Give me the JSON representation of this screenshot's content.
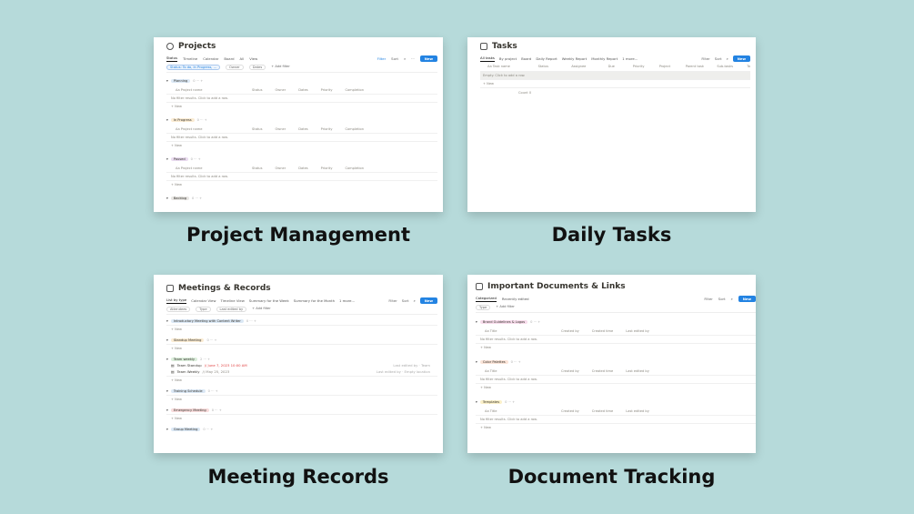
{
  "captions": {
    "project_management": "Project Management",
    "daily_tasks": "Daily Tasks",
    "meeting_records": "Meeting Records",
    "document_tracking": "Document Tracking"
  },
  "projects": {
    "title": "Projects",
    "tabs": [
      "Status",
      "Timeline",
      "Calendar",
      "Board",
      "All",
      "View"
    ],
    "toolbar": {
      "filter": "Filter",
      "sort": "Sort",
      "new": "New"
    },
    "filter_chips": [
      "Status: To do, In Progress, ...",
      "Owner",
      "Dates",
      "+ Add filter"
    ],
    "columns": [
      "Aa Project name",
      "Status",
      "Owner",
      "Dates",
      "Priority",
      "Completion"
    ],
    "empty_note": "No filter results. Click to add a row.",
    "add_label": "+ New",
    "groups": [
      {
        "label": "Planning",
        "color": "#dbe8f5"
      },
      {
        "label": "In Progress",
        "color": "#fbecd3"
      },
      {
        "label": "Paused",
        "color": "#eadcf0"
      },
      {
        "label": "Backlog",
        "color": "#e8e6e3"
      }
    ]
  },
  "tasks": {
    "title": "Tasks",
    "tabs": [
      "All tasks",
      "By project",
      "Board",
      "Daily Report",
      "Weekly Report",
      "Monthly Report",
      "1 more..."
    ],
    "toolbar": {
      "filter": "Filter",
      "sort": "Sort",
      "new": "New"
    },
    "columns": [
      "Aa Task name",
      "Status",
      "Assignee",
      "Due",
      "Priority",
      "Project",
      "Parent task",
      "Sub-tasks",
      "To"
    ],
    "empty_row": "Empty. Click to add a row.",
    "add_label": "+ New",
    "calc_label": "Count 0"
  },
  "meetings": {
    "title": "Meetings & Records",
    "tabs": [
      "List by type",
      "Calendar View",
      "Timeline View",
      "Summary for the Week",
      "Summary for the Month",
      "1 more..."
    ],
    "toolbar": {
      "filter": "Filter",
      "sort": "Sort",
      "new": "New"
    },
    "filter_chips": [
      "Attendees",
      "Type",
      "Last edited by",
      "+ Add filter"
    ],
    "add_label": "+ New",
    "groups": [
      {
        "label": "Introductory Meeting with Content Writer",
        "color": "#dbe8f5"
      },
      {
        "label": "Standup Meeting",
        "color": "#fbecd3"
      },
      {
        "label": "Team weekly",
        "color": "#dcefdc",
        "items": [
          {
            "name": "Team Standup",
            "date": "// June 7, 2023 10:00 AM",
            "red": true,
            "right": "Last edited by · Team"
          },
          {
            "name": "Team Weekly",
            "date": "// May 25, 2023",
            "red": false,
            "right": "Last edited by · Empty location"
          }
        ]
      },
      {
        "label": "Training Schedule",
        "color": "#dbe8f5"
      },
      {
        "label": "Emergency Meeting",
        "color": "#f8dcdc"
      },
      {
        "label": "Group Meeting",
        "color": "#dbe8f5"
      }
    ]
  },
  "documents": {
    "title": "Important Documents & Links",
    "tabs": [
      "Categorized",
      "Recently edited"
    ],
    "toolbar": {
      "filter": "Filter",
      "sort": "Sort",
      "new": "New"
    },
    "filter_chips": [
      "Type",
      "+ Add filter"
    ],
    "columns": [
      "Aa Title",
      "Created by",
      "Created time",
      "Last edited by"
    ],
    "empty_note": "No filter results. Click to add a row.",
    "add_label": "+ New",
    "groups": [
      {
        "label": "Brand Guidelines & Logos",
        "color": "#f8dcec"
      },
      {
        "label": "Color Palettes",
        "color": "#fbe4d8"
      },
      {
        "label": "Templates",
        "color": "#fbf0c8"
      }
    ]
  }
}
